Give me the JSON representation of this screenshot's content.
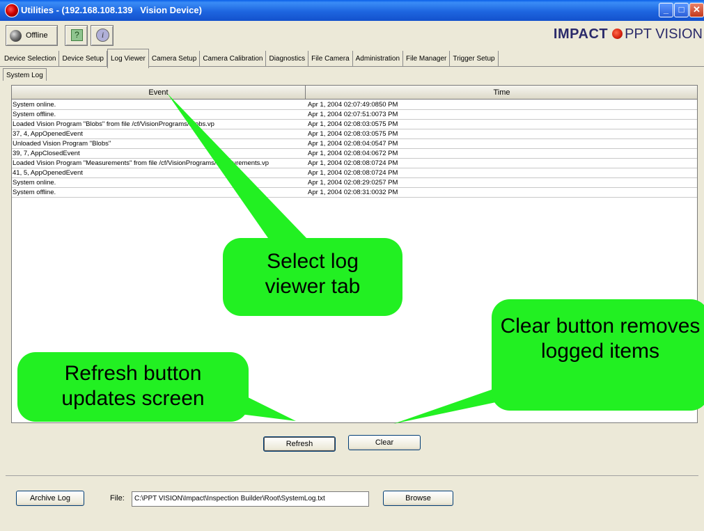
{
  "window": {
    "title": "Utilities - (192.168.108.139   Vision Device)",
    "minimize_icon": "minimize-icon",
    "maximize_icon": "maximize-icon",
    "close_icon": "close-icon"
  },
  "toolbar": {
    "offline_label": "Offline",
    "help_icon": "help-icon",
    "info_icon": "info-icon",
    "brand_bold": "IMPACT",
    "brand_regular": "PPT VISION"
  },
  "tabs": [
    {
      "label": "Device Selection",
      "active": false
    },
    {
      "label": "Device Setup",
      "active": false
    },
    {
      "label": "Log Viewer",
      "active": true
    },
    {
      "label": "Camera Setup",
      "active": false
    },
    {
      "label": "Camera Calibration",
      "active": false
    },
    {
      "label": "Diagnostics",
      "active": false
    },
    {
      "label": "File Camera",
      "active": false
    },
    {
      "label": "Administration",
      "active": false
    },
    {
      "label": "File Manager",
      "active": false
    },
    {
      "label": "Trigger Setup",
      "active": false
    }
  ],
  "subtab": {
    "label": "System Log"
  },
  "table": {
    "columns": [
      "Event",
      "Time"
    ],
    "rows": [
      {
        "event": "System online.",
        "time": "Apr 1, 2004 02:07:49:0850 PM"
      },
      {
        "event": "System offline.",
        "time": "Apr 1, 2004 02:07:51:0073 PM"
      },
      {
        "event": "Loaded Vision Program \"Blobs\" from file /cf/VisionPrograms/Blobs.vp",
        "time": "Apr 1, 2004 02:08:03:0575 PM"
      },
      {
        "event": "37, 4, AppOpenedEvent",
        "time": "Apr 1, 2004 02:08:03:0575 PM"
      },
      {
        "event": "Unloaded Vision Program \"Blobs\"",
        "time": "Apr 1, 2004 02:08:04:0547 PM"
      },
      {
        "event": "39, 7, AppClosedEvent",
        "time": "Apr 1, 2004 02:08:04:0672 PM"
      },
      {
        "event": "Loaded Vision Program \"Measurements\" from file /cf/VisionPrograms/Measurements.vp",
        "time": "Apr 1, 2004 02:08:08:0724 PM"
      },
      {
        "event": "41, 5, AppOpenedEvent",
        "time": "Apr 1, 2004 02:08:08:0724 PM"
      },
      {
        "event": "System online.",
        "time": "Apr 1, 2004 02:08:29:0257 PM"
      },
      {
        "event": "System offline.",
        "time": "Apr 1, 2004 02:08:31:0032 PM"
      }
    ]
  },
  "buttons": {
    "refresh": "Refresh",
    "clear": "Clear",
    "archive": "Archive Log",
    "browse": "Browse"
  },
  "file": {
    "label": "File:",
    "value": "C:\\PPT VISION\\Impact\\Inspection Builder\\Root\\SystemLog.txt"
  },
  "callouts": {
    "log_viewer": "Select log viewer tab",
    "refresh": "Refresh button updates screen",
    "clear": "Clear button removes logged items"
  },
  "colors": {
    "callout": "#22F022",
    "titlebar": "#1E66E0",
    "window_bg": "#ECE9D8"
  }
}
